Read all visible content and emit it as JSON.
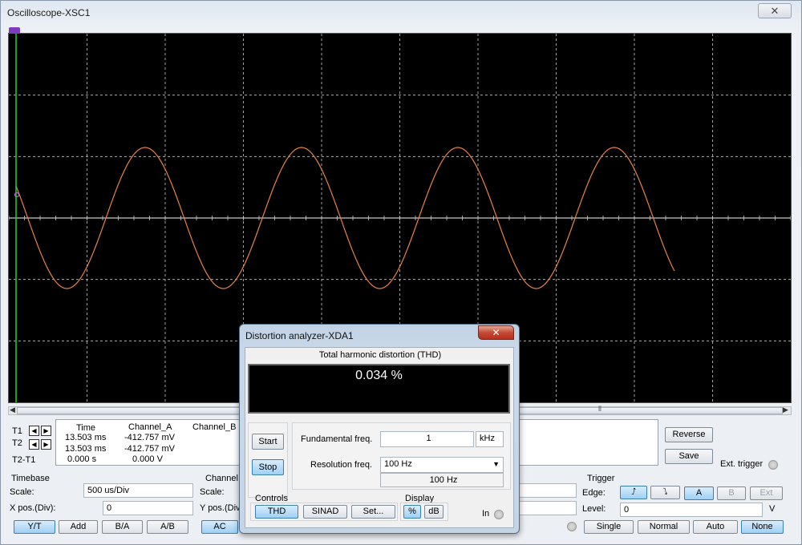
{
  "oscilloscope": {
    "title": "Oscilloscope-XSC1",
    "close_glyph": "✕",
    "colors": {
      "background": "#000000",
      "grid": "#c8c8c8",
      "trace_a": "#e8824a",
      "cursor_1": "#2ecc2e"
    },
    "scroll_grip": "⦀",
    "readout": {
      "headers": {
        "time": "Time",
        "channel_a": "Channel_A",
        "channel_b": "Channel_B"
      },
      "rows": [
        {
          "label": "T1",
          "time": "13.503 ms",
          "channel_a": "-412.757 mV"
        },
        {
          "label": "T2",
          "time": "13.503 ms",
          "channel_a": "-412.757 mV"
        },
        {
          "label": "T2-T1",
          "time": "0.000 s",
          "channel_a": "0.000 V"
        }
      ]
    },
    "reverse_label": "Reverse",
    "save_label": "Save",
    "ext_trigger_label": "Ext. trigger",
    "timebase": {
      "title": "Timebase",
      "scale_label": "Scale:",
      "scale_value": "500 us/Div",
      "xpos_label": "X pos.(Div):",
      "xpos_value": "0",
      "buttons": [
        "Y/T",
        "Add",
        "B/A",
        "A/B"
      ]
    },
    "channel_a": {
      "title": "Channel",
      "scale_label": "Scale:",
      "ypos_label": "Y pos.(Div",
      "ac_label": "AC"
    },
    "trigger": {
      "title": "Trigger",
      "edge_label": "Edge:",
      "rising_icon": "⭜",
      "falling_icon": "⭝",
      "source_a": "A",
      "source_b": "B",
      "source_ext": "Ext",
      "level_label": "Level:",
      "level_value": "0",
      "level_unit": "V",
      "modes": [
        "Single",
        "Normal",
        "Auto",
        "None"
      ]
    }
  },
  "distortion_analyzer": {
    "title": "Distortion analyzer-XDA1",
    "close_glyph": "✕",
    "caption": "Total harmonic distortion (THD)",
    "value": "0.034 %",
    "start_label": "Start",
    "stop_label": "Stop",
    "fundamental_label": "Fundamental freq.",
    "fundamental_value": "1",
    "fundamental_unit": "kHz",
    "resolution_label": "Resolution freq.",
    "resolution_value": "100 Hz",
    "resolution_readout": "100 Hz",
    "controls_label": "Controls",
    "thd_button": "THD",
    "sinad_button": "SINAD",
    "set_button": "Set...",
    "display_label": "Display",
    "percent_button": "%",
    "db_button": "dB",
    "in_label": "In"
  }
}
